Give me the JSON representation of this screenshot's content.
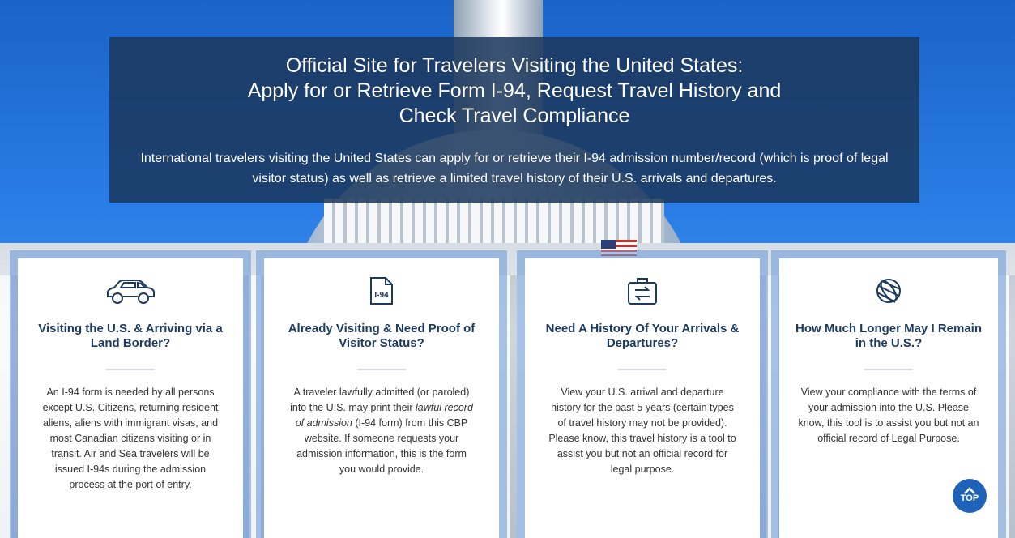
{
  "hero": {
    "title_line1": "Official Site for Travelers Visiting the United States:",
    "title_line2": "Apply for or Retrieve Form I-94, Request Travel History and",
    "title_line3": "Check Travel Compliance",
    "description": "International travelers visiting the United States can apply for or retrieve their I-94 admission number/record (which is proof of legal visitor status) as well as retrieve a limited travel history of their U.S. arrivals and departures."
  },
  "cards": [
    {
      "icon": "car-icon",
      "title": "Visiting the U.S. & Arriving via a Land Border?",
      "text": "An I-94 form is needed by all persons except U.S. Citizens, returning resident aliens, aliens with immigrant visas, and most Canadian citizens visiting or in transit. Air and Sea travelers will be issued I-94s during the admission process at the port of entry."
    },
    {
      "icon": "i94-document-icon",
      "icon_label": "I-94",
      "title": "Already Visiting & Need Proof of Visitor Status?",
      "text_before": "A traveler lawfully admitted (or paroled) into the U.S. may print their ",
      "text_emphasis": "lawful record of admission",
      "text_after": " (I-94 form) from this CBP website. If someone requests your admission information, this is the form you would provide."
    },
    {
      "icon": "travel-history-icon",
      "title": "Need A History Of Your Arrivals & Departures?",
      "text": "View your U.S. arrival and departure history for the past 5 years (certain types of travel history may not be provided). Please know, this travel history is a tool to assist you but not an official record for legal purpose."
    },
    {
      "icon": "globe-icon",
      "title": "How Much Longer May I Remain in the U.S.?",
      "text": "View your compliance with the terms of your admission into the U.S. Please know, this tool is to assist you but not an official record of Legal Purpose."
    }
  ],
  "top_button": {
    "label": "TOP",
    "icon": "chevron-up-icon"
  },
  "colors": {
    "hero_bg": "#1b375c",
    "card_title": "#1b3a5e",
    "accent": "#1f63b8"
  }
}
